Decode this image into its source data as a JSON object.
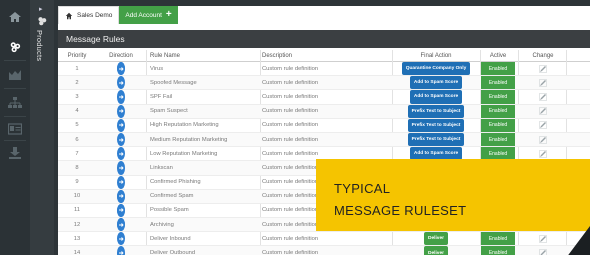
{
  "sidebar": {
    "icons": [
      "home-icon",
      "products-logo-icon",
      "chart-icon",
      "hierarchy-icon",
      "id-card-icon",
      "download-icon"
    ],
    "products_label": "Products"
  },
  "tabs": {
    "home_label": "Sales Demo",
    "add_label": "Add Account"
  },
  "section_title": "Message Rules",
  "table": {
    "headers": {
      "priority": "Priority",
      "direction": "Direction",
      "rule_name": "Rule Name",
      "description": "Description",
      "final_action": "Final Action",
      "active": "Active",
      "change": "Change"
    },
    "rows": [
      {
        "priority": "1",
        "dirs": 2,
        "name": "Virus",
        "desc": "Custom rule definition",
        "action": "Quarantine Company Only",
        "action_color": "blue",
        "status": "Enabled"
      },
      {
        "priority": "2",
        "dirs": 1,
        "name": "Spoofed Message",
        "desc": "Custom rule definition",
        "action": "Add to Spam Score",
        "action_color": "blue",
        "status": "Enabled"
      },
      {
        "priority": "3",
        "dirs": 1,
        "name": "SPF Fail",
        "desc": "Custom rule definition",
        "action": "Add to Spam Score",
        "action_color": "blue",
        "status": "Enabled"
      },
      {
        "priority": "4",
        "dirs": 1,
        "name": "Spam Suspect",
        "desc": "Custom rule definition",
        "action": "Prefix Text to Subject",
        "action_color": "blue",
        "status": "Enabled"
      },
      {
        "priority": "5",
        "dirs": 1,
        "name": "High Reputation Marketing",
        "desc": "Custom rule definition",
        "action": "Prefix Text to Subject",
        "action_color": "blue",
        "status": "Enabled"
      },
      {
        "priority": "6",
        "dirs": 1,
        "name": "Medium Reputation Marketing",
        "desc": "Custom rule definition",
        "action": "Prefix Text to Subject",
        "action_color": "blue",
        "status": "Enabled"
      },
      {
        "priority": "7",
        "dirs": 1,
        "name": "Low Reputation Marketing",
        "desc": "Custom rule definition",
        "action": "Add to Spam Score",
        "action_color": "blue",
        "status": "Enabled"
      },
      {
        "priority": "8",
        "dirs": 1,
        "name": "Linkscan",
        "desc": "Custom rule definition",
        "action": "",
        "action_color": "",
        "status": ""
      },
      {
        "priority": "9",
        "dirs": 1,
        "name": "Confirmed Phishing",
        "desc": "Custom rule definition",
        "action": "",
        "action_color": "",
        "status": ""
      },
      {
        "priority": "10",
        "dirs": 2,
        "name": "Confirmed Spam",
        "desc": "Custom rule definition",
        "action": "",
        "action_color": "",
        "status": ""
      },
      {
        "priority": "11",
        "dirs": 2,
        "name": "Possible Spam",
        "desc": "Custom rule definition",
        "action": "",
        "action_color": "",
        "status": ""
      },
      {
        "priority": "12",
        "dirs": 2,
        "name": "Archiving",
        "desc": "Custom rule definition",
        "action": "",
        "action_color": "",
        "status": ""
      },
      {
        "priority": "13",
        "dirs": 1,
        "name": "Deliver Inbound",
        "desc": "Custom rule definition",
        "action": "Deliver",
        "action_color": "green",
        "status": "Enabled"
      },
      {
        "priority": "14",
        "dirs": 1,
        "name": "Deliver Outbound",
        "desc": "Custom rule definition",
        "action": "Deliver",
        "action_color": "green",
        "status": "Enabled"
      }
    ]
  },
  "callout": {
    "line1": "TYPICAL",
    "line2": "MESSAGE RULESET",
    "color": "#f5c400"
  },
  "colors": {
    "rail": "#2b3236",
    "header": "#3b3f42",
    "enabled": "#43a047",
    "action_blue": "#1f6fb5"
  }
}
